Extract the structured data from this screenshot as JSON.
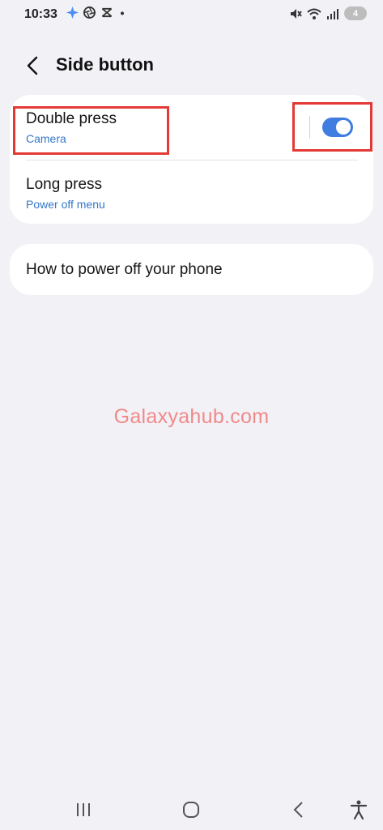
{
  "status_bar": {
    "time": "10:33",
    "left_icons": [
      "sparkle-icon",
      "aperture-icon",
      "capcut-icon",
      "dot-icon"
    ],
    "right_icons": [
      "mute-icon",
      "wifi-icon",
      "signal-icon"
    ],
    "battery_level": "4"
  },
  "header": {
    "title": "Side button",
    "back_icon": "chevron-left-icon"
  },
  "settings": {
    "double_press": {
      "title": "Double press",
      "subtitle": "Camera",
      "enabled": true
    },
    "long_press": {
      "title": "Long press",
      "subtitle": "Power off menu"
    },
    "power_off": {
      "title": "How to power off your phone"
    }
  },
  "watermark": "Galaxyahub.com",
  "colors": {
    "background": "#f2f1f6",
    "card": "#ffffff",
    "accent": "#3478c6",
    "toggle_on": "#3f7ee0",
    "highlight": "#e53935",
    "watermark": "#f08a8a"
  },
  "nav_bar": [
    "recents-icon",
    "home-icon",
    "back-icon",
    "accessibility-icon"
  ]
}
